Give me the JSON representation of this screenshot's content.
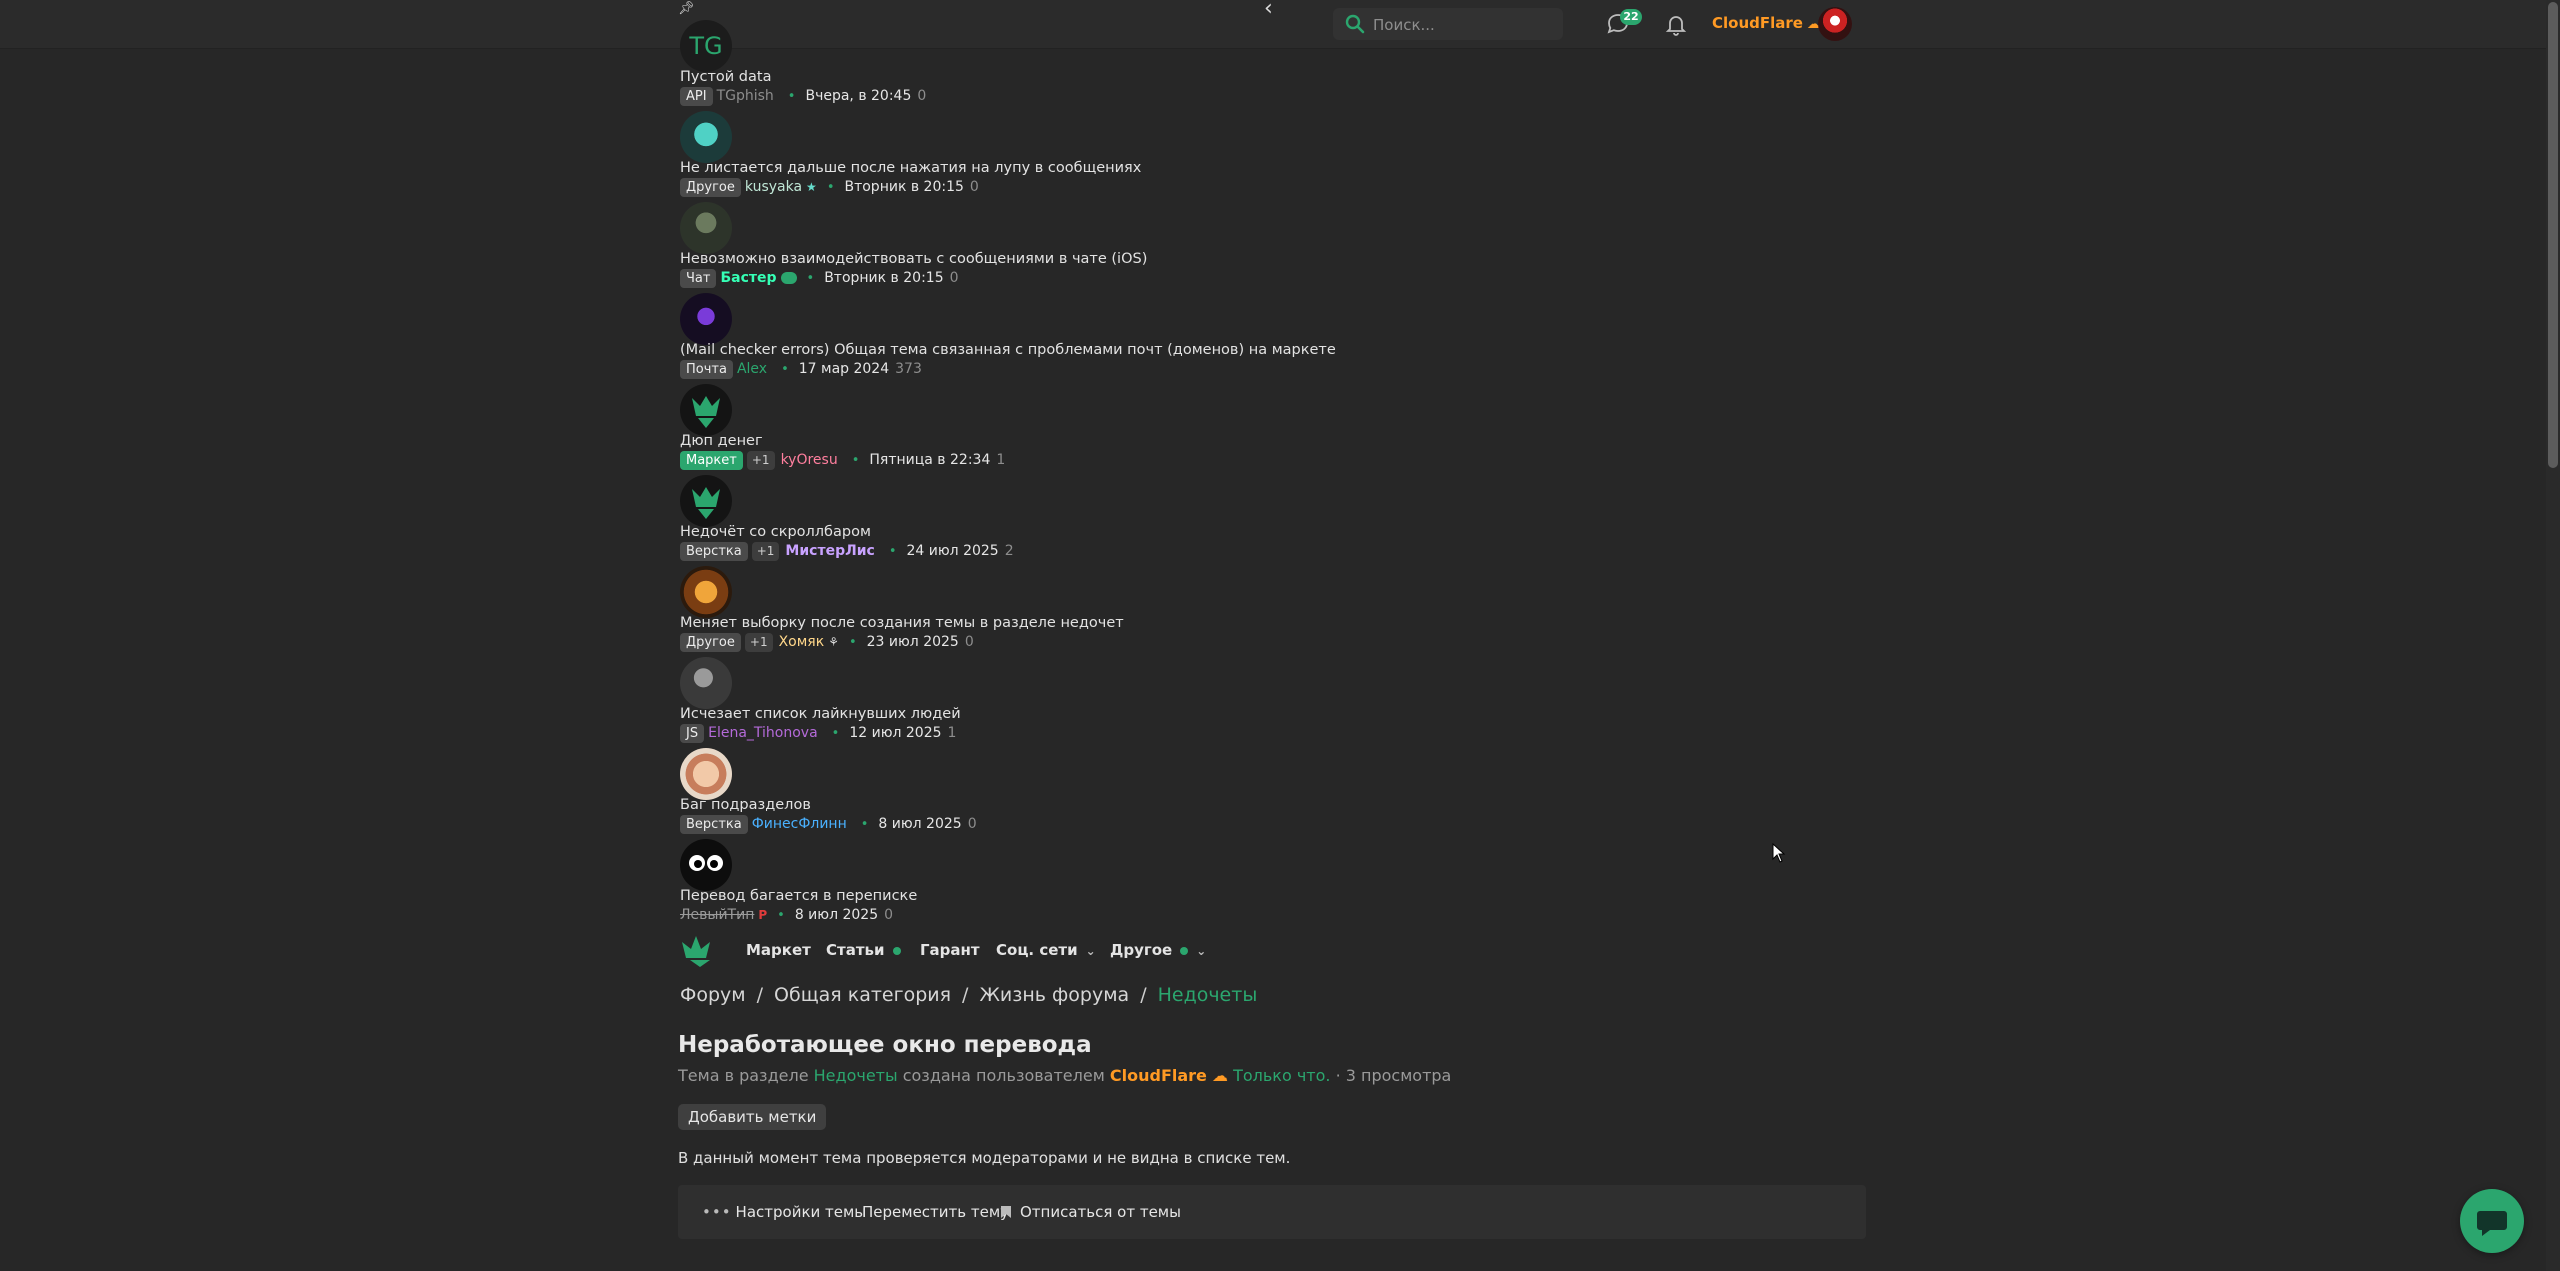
{
  "header": {
    "search_placeholder": "Поиск...",
    "messages_count": "22",
    "username": "CloudFlare",
    "user_badge_icon": "cloud-icon"
  },
  "threads": [
    {
      "avatar_text": "TG",
      "title": "Пустой data",
      "prefix": "API",
      "author": "TGphish",
      "author_color": "#8d8d8d",
      "date": "Вчера, в 20:45",
      "replies": "0"
    },
    {
      "title": "Не листается дальше после нажатия на лупу в сообщениях",
      "prefix": "Другое",
      "author": "kusyaka",
      "author_color": "#bfe6d5",
      "date": "Вторник в 20:15",
      "replies": "0"
    },
    {
      "title": "Невозможно взаимодействовать с сообщениями в чате (iOS)",
      "prefix": "Чат",
      "author": "Бастер",
      "author_color": "#35ffb5",
      "date": "Вторник в 20:15",
      "replies": "0"
    },
    {
      "title": "(Mail checker errors) Общая тема связанная с проблемами почт (доменов) на маркете",
      "prefix": "Почта",
      "author": "Alex",
      "author_color": "#2ba66e",
      "date": "17 мар 2024",
      "replies": "373"
    },
    {
      "title": "Дюп денег",
      "prefix": "Маркет",
      "plus": "+1",
      "author": "kyOresu",
      "author_color": "#ff7f9e",
      "date": "Пятница в 22:34",
      "replies": "1"
    },
    {
      "title": "Недочёт со скроллбаром",
      "prefix": "Верстка",
      "plus": "+1",
      "author": "МистерЛис",
      "author_color": "#c8a2ff",
      "date": "24 июл 2025",
      "replies": "2"
    },
    {
      "title": "Меняет выборку после создания темы в разделе недочет",
      "prefix": "Другое",
      "plus": "+1",
      "author": "Хомяк",
      "author_color": "#ffd78a",
      "date": "23 июл 2025",
      "replies": "0"
    },
    {
      "title": "Исчезает список лайкнувших людей",
      "prefix": "JS",
      "author": "Elena_Tihonova",
      "author_color": "#b46ad9",
      "date": "12 июл 2025",
      "replies": "1"
    },
    {
      "title": "Баг подразделов",
      "prefix": "Верстка",
      "author": "ФинесФлинн",
      "author_color": "#4ab1ff",
      "date": "8 июл 2025",
      "replies": "0"
    },
    {
      "title": "Перевод багается в переписке",
      "prefix": "",
      "author": "ЛевыйТип",
      "author_color": "#9a9a9a",
      "date": "8 июл 2025",
      "replies": "0"
    }
  ],
  "nav": {
    "market": "Маркет",
    "articles": "Статьи",
    "garant": "Гарант",
    "social": "Соц. сети",
    "other": "Другое"
  },
  "breadcrumbs": [
    "Форум",
    "Общая категория",
    "Жизнь форума",
    "Недочеты"
  ],
  "topic": {
    "title": "Неработающее окно перевода",
    "desc_prefix": "Тема в разделе",
    "section": "Недочеты",
    "desc_mid": "создана пользователем",
    "author": "CloudFlare",
    "time": "Только что.",
    "views": "· 3 просмотра",
    "add_tags": "Добавить метки",
    "notice": "В данный момент тема проверяется модераторами и не видна в списке тем."
  },
  "actions": {
    "settings": "Настройки темы",
    "move": "Переместить тему",
    "unsubscribe": "Отписаться от темы"
  },
  "colors": {
    "accent": "#2ba66e",
    "username_orange": "#ff9a24",
    "background": "#272727"
  }
}
